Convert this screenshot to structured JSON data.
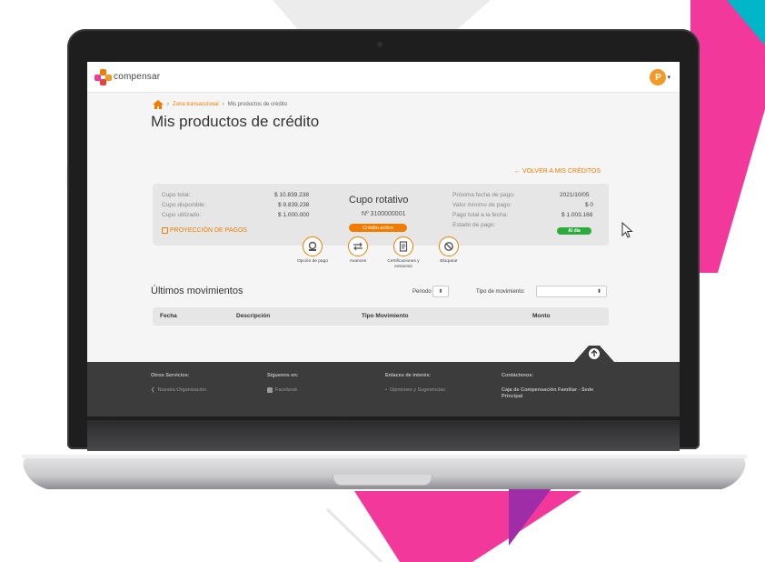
{
  "app": {
    "logo_text": "compensar",
    "avatar_initial": "P"
  },
  "breadcrumb": {
    "items": [
      "Zona transaccional",
      "Mis productos de crédito"
    ]
  },
  "page": {
    "title": "Mis productos de crédito",
    "back_link": "← VOLVER A MIS CRÉDITOS"
  },
  "card": {
    "left_rows": [
      {
        "label": "Cupo total:",
        "value": "$ 10.839.238"
      },
      {
        "label": "Cupo disponible:",
        "value": "$ 9.839.238"
      },
      {
        "label": "Cupo utilizado:",
        "value": "$ 1.000.000"
      }
    ],
    "projection_link": "PROYECCIÓN DE PAGOS",
    "product_name": "Cupo rotativo",
    "product_number": "Nº 3100000001",
    "status_badge": "Crédito activo",
    "right_rows": [
      {
        "label": "Próxima fecha de pago:",
        "value": "2021/10/05"
      },
      {
        "label": "Valor mínimo de pago:",
        "value": "$ 0"
      },
      {
        "label": "Pago total a la fecha:",
        "value": "$ 1.003.168"
      },
      {
        "label": "Estado de pago:",
        "value": "Al día"
      }
    ]
  },
  "actions": [
    {
      "label": "Opción de pago",
      "icon": "payment-icon"
    },
    {
      "label": "Avances",
      "icon": "transfer-arrows-icon"
    },
    {
      "label": "Certificaciones y extractos",
      "icon": "document-icon"
    },
    {
      "label": "Bloquear",
      "icon": "block-icon"
    }
  ],
  "movements": {
    "title": "Últimos movimientos",
    "period_label": "Periodo",
    "type_label": "Tipo de movimiento:",
    "columns": [
      "Fecha",
      "Descripción",
      "Tipo Movimiento",
      "Monto"
    ]
  },
  "footer": {
    "columns": [
      {
        "heading": "Otros Servicios:",
        "item": "Nuestra Organización"
      },
      {
        "heading": "Síguenos en:",
        "item": "Facebook"
      },
      {
        "heading": "Enlaces de interés:",
        "item": "Opiniones y Sugerencias"
      },
      {
        "heading": "Contáctenos:",
        "item": "Caja de Compensación Familiar - Sede Principal"
      }
    ]
  },
  "colors": {
    "brand_orange": "#f07d00",
    "status_green": "#2eaa3c",
    "footer_bg": "#3c3c3c"
  }
}
